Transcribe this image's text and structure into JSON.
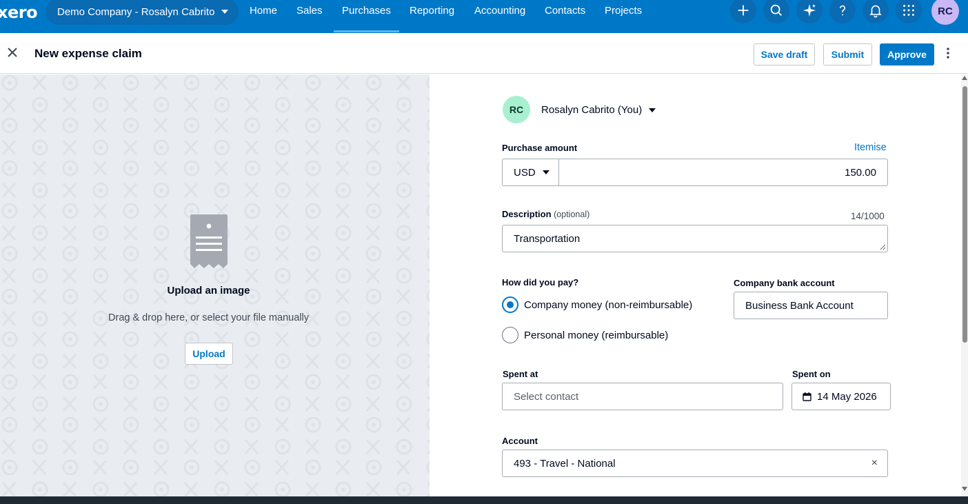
{
  "nav": {
    "logo": "xero",
    "organisation": "Demo Company - Rosalyn Cabrito",
    "links": [
      "Home",
      "Sales",
      "Purchases",
      "Reporting",
      "Accounting",
      "Contacts",
      "Projects"
    ],
    "active": "Purchases",
    "user_initials": "RC",
    "icons": [
      "plus-icon",
      "search-icon",
      "sparkle-icon",
      "help-icon",
      "bell-icon",
      "apps-grid-icon"
    ]
  },
  "header": {
    "title": "New expense claim",
    "save_draft": "Save draft",
    "submit": "Submit",
    "approve": "Approve"
  },
  "upload": {
    "title": "Upload an image",
    "subtitle": "Drag & drop here, or select your file manually",
    "button": "Upload"
  },
  "form": {
    "claimant_initials": "RC",
    "claimant_name": "Rosalyn Cabrito (You)",
    "purchase_amount_label": "Purchase amount",
    "itemise_link": "Itemise",
    "currency": "USD",
    "amount": "150.00",
    "description_label": "Description",
    "description_optional": "(optional)",
    "description_counter": "14/1000",
    "description_value": "Transportation",
    "pay_label": "How did you pay?",
    "pay_options": [
      "Company money (non-reimbursable)",
      "Personal money (reimbursable)"
    ],
    "pay_selected_index": 0,
    "bank_label": "Company bank account",
    "bank_value": "Business Bank Account",
    "spent_at_label": "Spent at",
    "spent_at_placeholder": "Select contact",
    "spent_on_label": "Spent on",
    "spent_on_value": "14 May 2026",
    "account_label": "Account",
    "account_value": "493 - Travel - National",
    "account_clear": "×"
  },
  "colors": {
    "brand": "#0078c8",
    "nav_bg": "#0078c8",
    "left_pane_bg": "#e9edf1",
    "claimant_avatar": "#a8f0d0",
    "user_avatar": "#c9b8f5"
  }
}
